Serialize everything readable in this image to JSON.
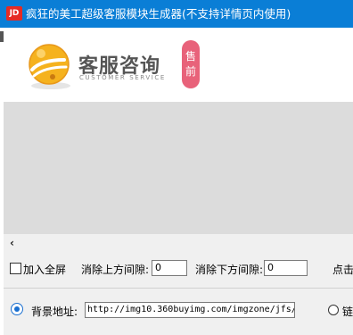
{
  "window": {
    "icon_text": "JD",
    "title": "疯狂的美工超级客服模块生成器(不支持详情页内使用)"
  },
  "banner": {
    "brand_cn": "客服咨询",
    "brand_en": "CUSTOMER SERVICE",
    "presale_label": "售前",
    "logo_icon": "bell-logo-icon"
  },
  "scrollbar": {
    "left_arrow": "‹"
  },
  "options": {
    "fullscreen_label": "加入全屏",
    "fullscreen_checked": false,
    "top_gap_label": "消除上方间隙:",
    "top_gap_value": "0",
    "bottom_gap_label": "消除下方间隙:",
    "bottom_gap_value": "0",
    "click_label_partial": "点击"
  },
  "background": {
    "label": "背景地址:",
    "url_value": "http://img10.360buyimg.com/imgzone/jfs/",
    "link_label_partial": "链"
  },
  "colors": {
    "titlebar": "#0a7ed6",
    "presale_badge": "#e8627a",
    "logo_gold": "#f5b21e"
  }
}
